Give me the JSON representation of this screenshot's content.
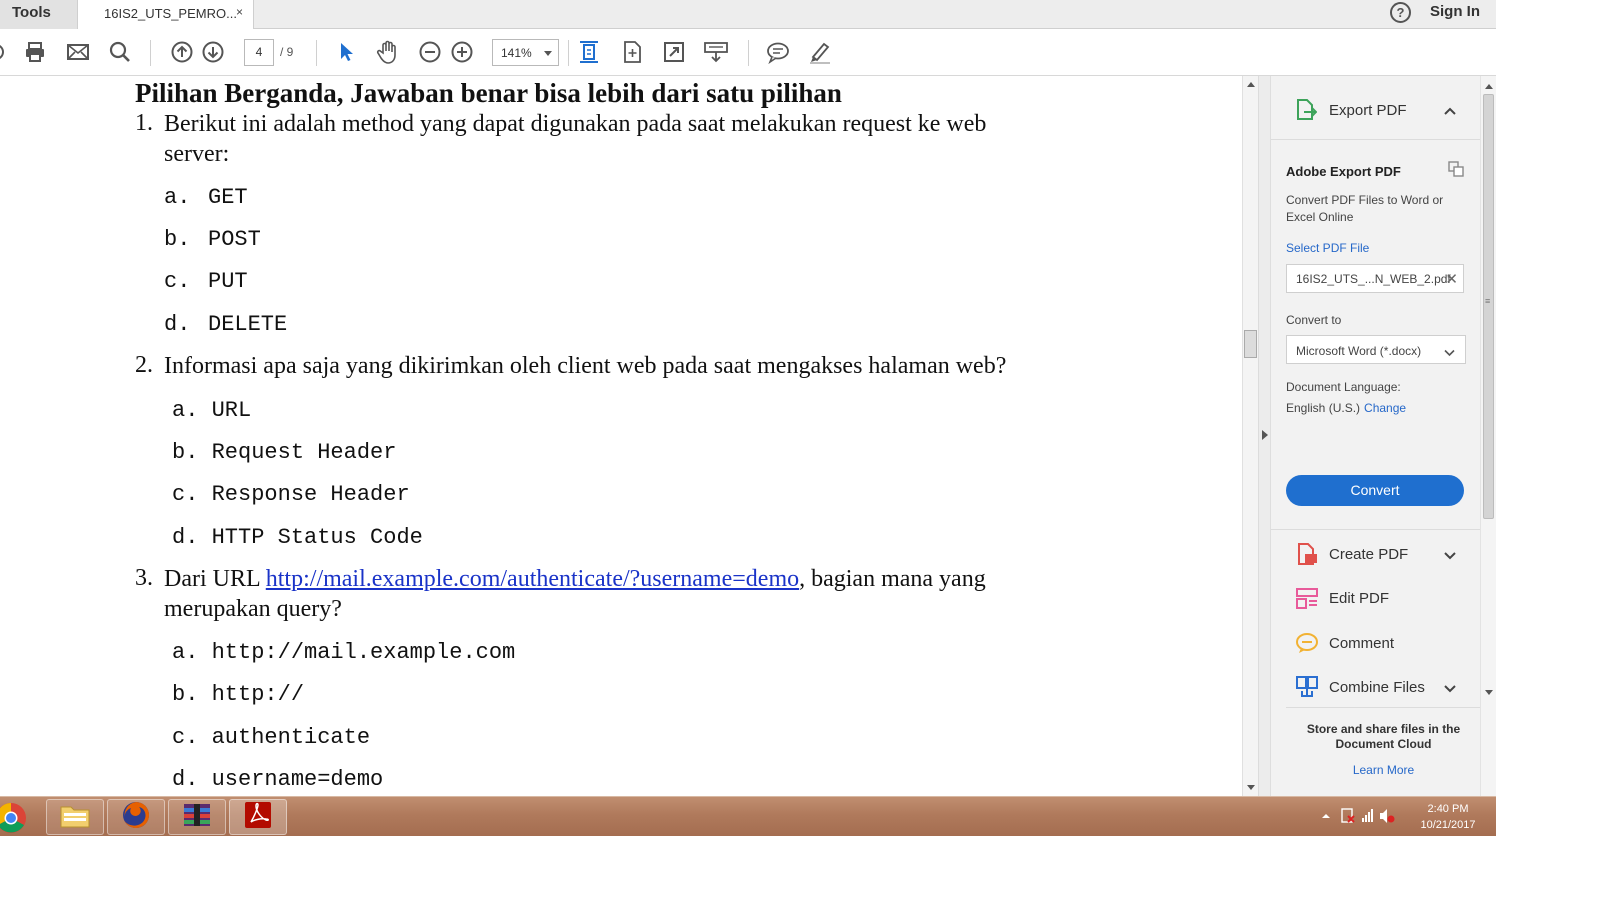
{
  "tabs": {
    "tools_label": "Tools",
    "doc_tab_label": "16IS2_UTS_PEMRO...",
    "doc_tab_close": "×"
  },
  "header": {
    "help_glyph": "?",
    "sign_in_label": "Sign In"
  },
  "toolbar": {
    "page_current": "4",
    "page_total": "/ 9",
    "zoom": "141%"
  },
  "document": {
    "heading": "Pilihan Berganda, Jawaban benar bisa lebih dari satu pilihan",
    "questions": [
      {
        "number": "1.",
        "line1": "Berikut ini adalah method yang dapat digunakan pada saat melakukan request ke web",
        "line2": "server:",
        "options": [
          {
            "letter": "a.",
            "text": "GET"
          },
          {
            "letter": "b.",
            "text": "POST"
          },
          {
            "letter": "c.",
            "text": "PUT"
          },
          {
            "letter": "d.",
            "text": "DELETE"
          }
        ]
      },
      {
        "number": "2.",
        "line1": "Informasi apa saja yang dikirimkan oleh client web pada saat mengakses halaman web?",
        "options": [
          {
            "letter": "a.",
            "text": "URL"
          },
          {
            "letter": "b.",
            "text": "Request Header"
          },
          {
            "letter": "c.",
            "text": "Response Header"
          },
          {
            "letter": "d.",
            "text": "HTTP Status Code"
          }
        ]
      },
      {
        "number": "3.",
        "line1_prefix": "Dari URL ",
        "line1_link": "http://mail.example.com/authenticate/?username=demo",
        "line1_suffix": ", bagian mana yang",
        "line2": "merupakan query?",
        "options": [
          {
            "letter": "a.",
            "text": "http://mail.example.com"
          },
          {
            "letter": "b.",
            "text": "http://"
          },
          {
            "letter": "c.",
            "text": "authenticate"
          },
          {
            "letter": "d.",
            "text": "username=demo"
          }
        ]
      }
    ]
  },
  "right_pane": {
    "export_header_label": "Export PDF",
    "export": {
      "title": "Adobe Export PDF",
      "description": "Convert PDF Files to Word or Excel Online",
      "select_file_link": "Select PDF File",
      "file_name": "16IS2_UTS_...N_WEB_2.pdf",
      "file_clear": "✕",
      "convert_to_label": "Convert to",
      "convert_to_value": "Microsoft Word (*.docx)",
      "language_label": "Document Language:",
      "language_value": "English (U.S.)",
      "language_change": "Change",
      "convert_button": "Convert"
    },
    "tools": [
      {
        "label": "Create PDF",
        "icon": "create-pdf-icon",
        "color": "#e0514b"
      },
      {
        "label": "Edit PDF",
        "icon": "edit-pdf-icon",
        "color": "#e85a9a"
      },
      {
        "label": "Comment",
        "icon": "comment-icon",
        "color": "#f2b233"
      },
      {
        "label": "Combine Files",
        "icon": "combine-files-icon",
        "color": "#2b6fd1"
      }
    ],
    "cloud_text": "Store and share files in the Document Cloud",
    "cloud_link": "Learn More"
  },
  "taskbar": {
    "time": "2:40 PM",
    "date": "10/21/2017"
  },
  "colors": {
    "accent_blue": "#1f6fcf",
    "link_blue": "#2668c9",
    "doc_link": "#1a33c8",
    "taskbar": "#b07a5c"
  }
}
